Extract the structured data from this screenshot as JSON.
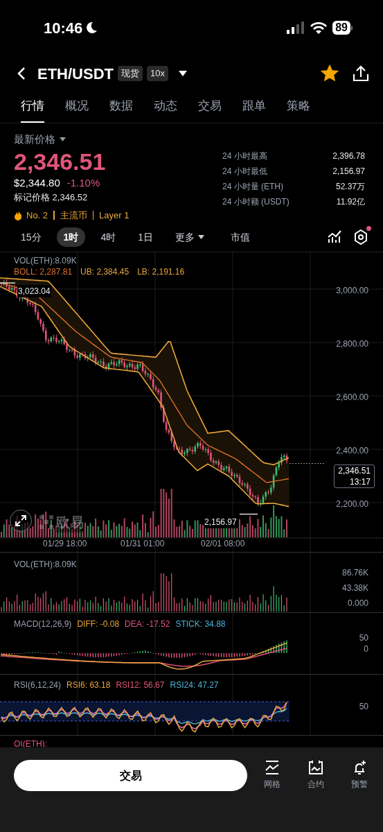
{
  "status_bar": {
    "time": "10:46",
    "battery": "89"
  },
  "header": {
    "pair": "ETH/USDT",
    "tags": [
      "现货",
      "10x"
    ],
    "favorite": true
  },
  "tabs": [
    {
      "label": "行情",
      "selected": true
    },
    {
      "label": "概况",
      "selected": false
    },
    {
      "label": "数据",
      "selected": false
    },
    {
      "label": "动态",
      "selected": false
    },
    {
      "label": "交易",
      "selected": false
    },
    {
      "label": "跟单",
      "selected": false
    },
    {
      "label": "策略",
      "selected": false
    }
  ],
  "price": {
    "label": "最新价格",
    "last": "2,346.51",
    "usd": "$2,344.80",
    "change": "-1.10%",
    "mark_label": "标记价格 2,346.52",
    "badges": [
      "No. 2",
      "主流币",
      "Layer 1"
    ]
  },
  "stats": [
    {
      "label": "24 小时最高",
      "value": "2,396.78"
    },
    {
      "label": "24 小时最低",
      "value": "2,156.97"
    },
    {
      "label": "24 小时量 (ETH)",
      "value": "52.37万"
    },
    {
      "label": "24 小时额 (USDT)",
      "value": "11.92亿"
    }
  ],
  "intervals": [
    {
      "label": "15分",
      "kind": "option",
      "selected": false
    },
    {
      "label": "1时",
      "kind": "option",
      "selected": true
    },
    {
      "label": "4时",
      "kind": "option",
      "selected": false
    },
    {
      "label": "1日",
      "kind": "option",
      "selected": false
    },
    {
      "label": "更多",
      "kind": "dropdown",
      "selected": false
    },
    {
      "label": "市值",
      "kind": "option",
      "selected": false
    }
  ],
  "settings_notification": true,
  "main_chart": {
    "vol_label": "VOL(ETH):8.09K",
    "boll": [
      {
        "text": "BOLL: 2,287.81",
        "color": "#e0702a"
      },
      {
        "text": "UB: 2,384.45",
        "color": "#eaa63c"
      },
      {
        "text": "LB: 2,191.16",
        "color": "#eaa63c"
      }
    ],
    "y_labels": [
      "3,000.00",
      "2,800.00",
      "2,600.00",
      "2,400.00",
      "2,200.00"
    ],
    "high_marker": "3,023.04",
    "low_marker": "2,156.97",
    "last_price": "2,346.51",
    "countdown": "13:17",
    "x_labels": [
      "01/29 18:00",
      "01/31 01:00",
      "02/01 08:00"
    ],
    "watermark": "欧易"
  },
  "volume_panel": {
    "label": "VOL(ETH):8.09K",
    "y_labels": [
      "86.76K",
      "43.38K",
      "0.000"
    ]
  },
  "macd_panel": {
    "label": "MACD(12,26,9)",
    "values": [
      {
        "text": "DIFF: -0.08",
        "color": "#eaa63c"
      },
      {
        "text": "DEA: -17.52",
        "color": "#e0557a"
      },
      {
        "text": "STICK: 34.88",
        "color": "#4fb3d9"
      }
    ],
    "y_labels": [
      "50",
      "0"
    ]
  },
  "rsi_panel": {
    "label": "RSI(6,12,24)",
    "values": [
      {
        "text": "RSI6: 63.18",
        "color": "#eaa63c"
      },
      {
        "text": "RSI12: 56.67",
        "color": "#e0557a"
      },
      {
        "text": "RSI24: 47.27",
        "color": "#4fb3d9"
      }
    ],
    "y_labels": [
      "50"
    ]
  },
  "oi_panel": {
    "label": "OI(ETH):"
  },
  "bottom_bar": {
    "trade_button": "交易",
    "actions": [
      {
        "label": "网格"
      },
      {
        "label": "合约"
      },
      {
        "label": "预警"
      }
    ]
  }
}
